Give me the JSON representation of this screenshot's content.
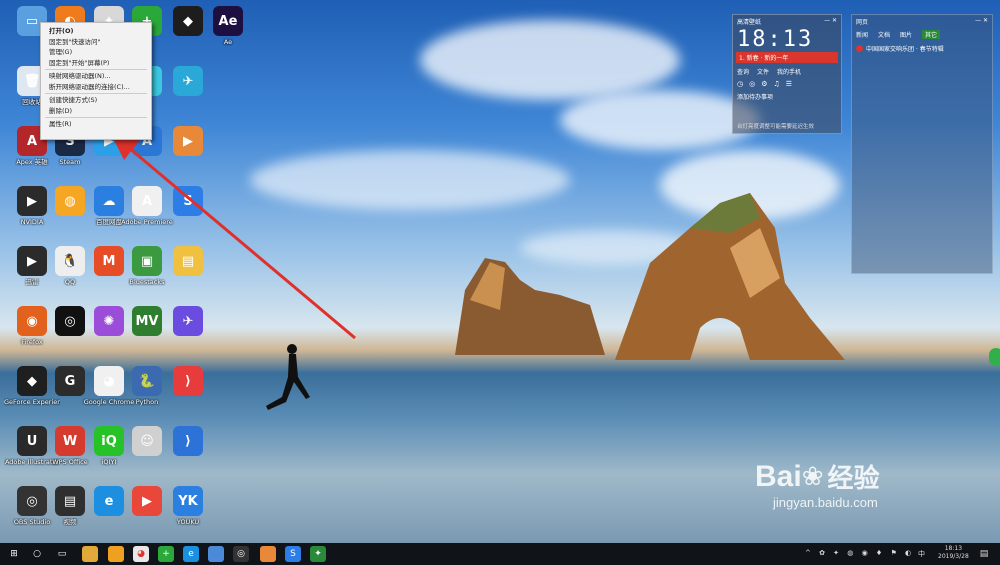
{
  "context_menu": {
    "items": [
      "打开(O)",
      "固定到\"快速访问\"",
      "管理(G)",
      "固定到\"开始\"屏幕(P)",
      "映射网络驱动器(N)...",
      "断开网络驱动器的连接(C)...",
      "创建快捷方式(S)",
      "删除(D)",
      "属性(R)"
    ]
  },
  "desktop_icons": [
    {
      "label": "",
      "color": "#5aa0e0",
      "glyph": "▭",
      "icon": "this-pc-icon"
    },
    {
      "label": "回收站",
      "color": "#dfe8f0",
      "glyph": "🗑",
      "icon": "recycle-bin-icon"
    },
    {
      "label": "Apex 英雄",
      "color": "#b3262a",
      "glyph": "A",
      "icon": "apex-icon"
    },
    {
      "label": "NVIDIA",
      "color": "#2b2b2b",
      "glyph": "▶",
      "icon": "nvidia-icon"
    },
    {
      "label": "迅雷",
      "color": "#2b2b2b",
      "glyph": "▶",
      "icon": "xunlei-icon"
    },
    {
      "label": "Firefox",
      "color": "#e2621d",
      "glyph": "◉",
      "icon": "firefox-icon"
    },
    {
      "label": "GeForce Experience",
      "color": "#1f1f1f",
      "glyph": "◆",
      "icon": "geforce-icon"
    },
    {
      "label": "Adobe Illustrator",
      "color": "#2a2a2a",
      "glyph": "U",
      "icon": "ui-icon"
    },
    {
      "label": "OBS Studio",
      "color": "#333",
      "glyph": "◎",
      "icon": "obs-icon"
    },
    {
      "label": "",
      "color": "#f07b1d",
      "glyph": "◐",
      "icon": "browser-icon"
    },
    {
      "label": "",
      "color": "#2e7ce0",
      "glyph": "◉",
      "icon": "qqbrowser-icon"
    },
    {
      "label": "Steam",
      "color": "#1a2a44",
      "glyph": "S",
      "icon": "steam-icon"
    },
    {
      "label": "",
      "color": "#f5a623",
      "glyph": "◍",
      "icon": "game-icon"
    },
    {
      "label": "QQ",
      "color": "#eeeeee",
      "glyph": "🐧",
      "icon": "qq-icon"
    },
    {
      "label": "",
      "color": "#111",
      "glyph": "◎",
      "icon": "music-icon"
    },
    {
      "label": "",
      "color": "#2c2c2c",
      "glyph": "G",
      "icon": "gdrive-icon"
    },
    {
      "label": "WPS Office",
      "color": "#d43b2e",
      "glyph": "W",
      "icon": "wps-icon"
    },
    {
      "label": "视频",
      "color": "#2f2f2f",
      "glyph": "▤",
      "icon": "video-icon"
    },
    {
      "label": "",
      "color": "#d8d8d8",
      "glyph": "✦",
      "icon": "tool-icon"
    },
    {
      "label": "",
      "color": "#e44",
      "glyph": "◍",
      "icon": "mail-icon"
    },
    {
      "label": "",
      "color": "#2ba0e8",
      "glyph": "▶",
      "icon": "player-icon"
    },
    {
      "label": "百度网盘",
      "color": "#2a7fe0",
      "glyph": "☁",
      "icon": "baidu-pan-icon"
    },
    {
      "label": "",
      "color": "#e64c26",
      "glyph": "M",
      "icon": "mv-icon"
    },
    {
      "label": "",
      "color": "#9b4cd8",
      "glyph": "✺",
      "icon": "paint-icon"
    },
    {
      "label": "Google Chrome",
      "color": "#f0f0f0",
      "glyph": "◕",
      "icon": "chrome-icon"
    },
    {
      "label": "iQIYI",
      "color": "#27c227",
      "glyph": "iQ",
      "icon": "iqiyi-icon"
    },
    {
      "label": "",
      "color": "#1c8fe0",
      "glyph": "e",
      "icon": "ie-icon"
    },
    {
      "label": "",
      "color": "#2aa83a",
      "glyph": "+",
      "icon": "360-icon"
    },
    {
      "label": "",
      "color": "#3ac8e0",
      "glyph": "◉",
      "icon": "cloud-icon"
    },
    {
      "label": "",
      "color": "#2b77d6",
      "glyph": "A",
      "icon": "game2-icon"
    },
    {
      "label": "Adobe Premiere",
      "color": "#f0f0f0",
      "glyph": "A",
      "icon": "arrow-icon"
    },
    {
      "label": "Bluestacks",
      "color": "#3b9a3f",
      "glyph": "▣",
      "icon": "bluestacks-icon"
    },
    {
      "label": "",
      "color": "#2f7d2f",
      "glyph": "MV",
      "icon": "mv-green-icon"
    },
    {
      "label": "Python",
      "color": "#3c6ab0",
      "glyph": "🐍",
      "icon": "python-icon"
    },
    {
      "label": "",
      "color": "#d0d0d0",
      "glyph": "☺",
      "icon": "cloud-face-icon"
    },
    {
      "label": "",
      "color": "#e8473a",
      "glyph": "▶",
      "icon": "video2-icon"
    },
    {
      "label": "",
      "color": "#1d1d1d",
      "glyph": "◆",
      "icon": "game3-icon"
    },
    {
      "label": "",
      "color": "#2aa8d8",
      "glyph": "✈",
      "icon": "plane-icon"
    },
    {
      "label": "",
      "color": "#e8893a",
      "glyph": "▶",
      "icon": "player2-icon"
    },
    {
      "label": "",
      "color": "#2d7de6",
      "glyph": "S",
      "icon": "s-icon"
    },
    {
      "label": "",
      "color": "#f0c040",
      "glyph": "▤",
      "icon": "folder-icon"
    },
    {
      "label": "",
      "color": "#6a4ce0",
      "glyph": "✈",
      "icon": "feishu-icon"
    },
    {
      "label": "",
      "color": "#e83b3b",
      "glyph": "⟩",
      "icon": "swap-icon"
    },
    {
      "label": "",
      "color": "#2d72d6",
      "glyph": "⟩",
      "icon": "app-icon"
    },
    {
      "label": "YOUKU",
      "color": "#2b7fe0",
      "glyph": "YK",
      "icon": "youku-icon"
    },
    {
      "label": "Ae",
      "color": "#1d1040",
      "glyph": "Ae",
      "icon": "ae-icon"
    }
  ],
  "widget_clock": {
    "title": "高清壁纸",
    "time": "18:13",
    "subtitle": "1. 新春 · 新的一年",
    "row1": [
      "查询",
      "文件",
      "我的手机"
    ],
    "row2": "添加待办事项",
    "footer": "台灯亮度调整可能需要延迟生效"
  },
  "widget_news": {
    "tabs": [
      "网页",
      "新闻",
      "文档",
      "图片",
      "其它"
    ],
    "headline": "中国国家交响乐团 · 春节特辑"
  },
  "taskbar": {
    "time": "18:13",
    "date": "2019/3/28",
    "language": "中"
  },
  "watermark": {
    "brand": "Bai",
    "brand2": "经验",
    "url": "jingyan.baidu.com"
  },
  "colors": {
    "arrow": "#e0302b",
    "widget_red": "#d9362e",
    "taskbar": "#101418"
  }
}
